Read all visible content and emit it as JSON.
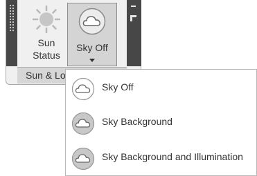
{
  "ribbon_panel": {
    "title": "Sun & Location",
    "sun_status": {
      "line1": "Sun",
      "line2": "Status",
      "icon": "sun-icon"
    },
    "sky_button": {
      "label": "Sky Off",
      "icon": "cloud-icon"
    }
  },
  "dropdown": {
    "items": [
      {
        "label": "Sky Off",
        "icon": "cloud-outline-icon"
      },
      {
        "label": "Sky Background",
        "icon": "cloud-gray-circle-icon"
      },
      {
        "label": "Sky Background and Illumination",
        "icon": "cloud-gray-circle-icon"
      }
    ]
  },
  "colors": {
    "panel_bg": "#f0f0f0",
    "strip_dark": "#474747",
    "selected_btn": "#d4d4d4",
    "menu_bg": "#ffffff"
  }
}
